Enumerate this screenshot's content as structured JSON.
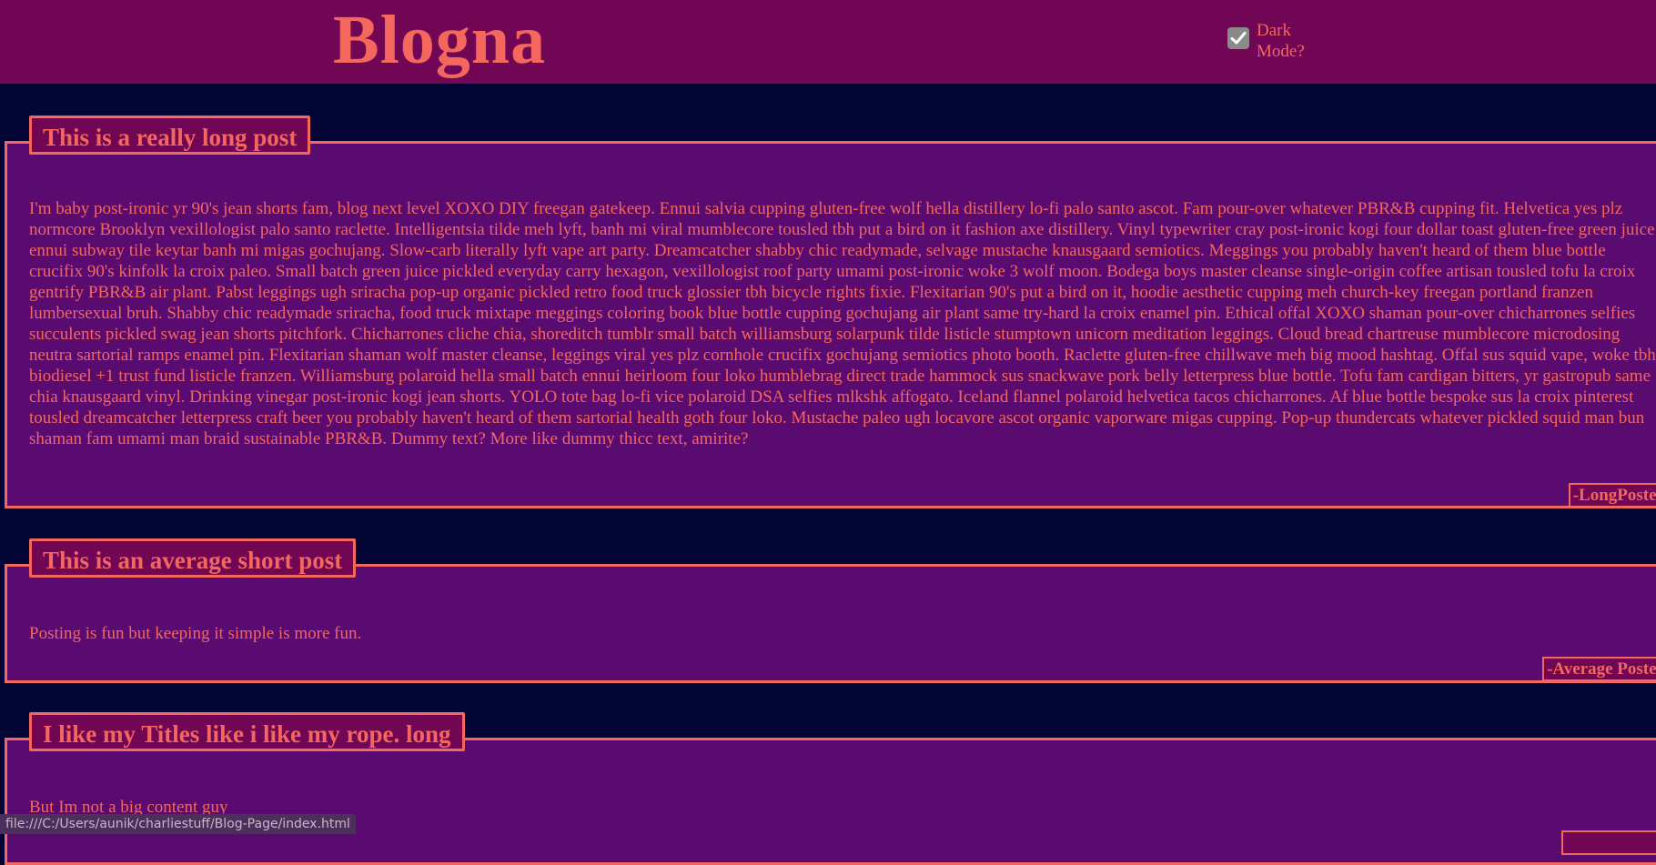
{
  "header": {
    "site_title": "Blogna",
    "dark_mode_label": "Dark Mode?",
    "dark_mode_checked": true
  },
  "posts": [
    {
      "title": "This is a really long post",
      "body": "I'm baby post-ironic yr 90's jean shorts fam, blog next level XOXO DIY freegan gatekeep. Ennui salvia cupping gluten-free wolf hella distillery lo-fi palo santo ascot. Fam pour-over whatever PBR&B cupping fit. Helvetica yes plz normcore Brooklyn vexillologist palo santo raclette. Intelligentsia tilde meh lyft, banh mi viral mumblecore tousled tbh put a bird on it fashion axe distillery. Vinyl typewriter cray post-ironic kogi four dollar toast gluten-free green juice ennui subway tile keytar banh mi migas gochujang. Slow-carb literally lyft vape art party. Dreamcatcher shabby chic readymade, selvage mustache knausgaard semiotics. Meggings you probably haven't heard of them blue bottle crucifix 90's kinfolk la croix paleo. Small batch green juice pickled everyday carry hexagon, vexillologist roof party umami post-ironic woke 3 wolf moon. Bodega boys master cleanse single-origin coffee artisan tousled tofu la croix gentrify PBR&B air plant. Pabst leggings ugh sriracha pop-up organic pickled retro food truck glossier tbh bicycle rights fixie. Flexitarian 90's put a bird on it, hoodie aesthetic cupping meh church-key freegan portland franzen lumbersexual bruh. Shabby chic readymade sriracha, food truck mixtape meggings coloring book blue bottle cupping gochujang air plant same try-hard la croix enamel pin. Ethical offal XOXO shaman pour-over chicharrones selfies succulents pickled swag jean shorts pitchfork. Chicharrones cliche chia, shoreditch tumblr small batch williamsburg solarpunk tilde listicle stumptown unicorn meditation leggings. Cloud bread chartreuse mumblecore microdosing neutra sartorial ramps enamel pin. Flexitarian shaman wolf master cleanse, leggings viral yes plz cornhole crucifix gochujang semiotics photo booth. Raclette gluten-free chillwave meh big mood hashtag. Offal sus squid vape, woke tbh biodiesel +1 trust fund listicle franzen. Williamsburg polaroid hella small batch ennui heirloom four loko humblebrag direct trade hammock sus snackwave pork belly letterpress blue bottle. Tofu fam cardigan bitters, yr gastropub same chia knausgaard vinyl. Drinking vinegar post-ironic kogi jean shorts. YOLO tote bag lo-fi vice polaroid DSA selfies mlkshk affogato. Iceland flannel polaroid helvetica tacos chicharrones. Af blue bottle bespoke sus la croix pinterest tousled dreamcatcher letterpress craft beer you probably haven't heard of them sartorial health goth four loko. Mustache paleo ugh locavore ascot organic vaporware migas cupping. Pop-up thundercats whatever pickled squid man bun shaman fam umami man braid sustainable PBR&B. Dummy text? More like dummy thicc text, amirite?",
      "author": "-LongPoster"
    },
    {
      "title": "This is an average short post",
      "body": "Posting is fun but keeping it simple is more fun.",
      "author": "-Average Poster"
    },
    {
      "title": "I like my Titles like i like my rope. long",
      "body": "But Im not a big content guy",
      "author": ""
    }
  ],
  "status_bar": {
    "url": "file:///C:/Users/aunik/charliestuff/Blog-Page/index.html"
  }
}
